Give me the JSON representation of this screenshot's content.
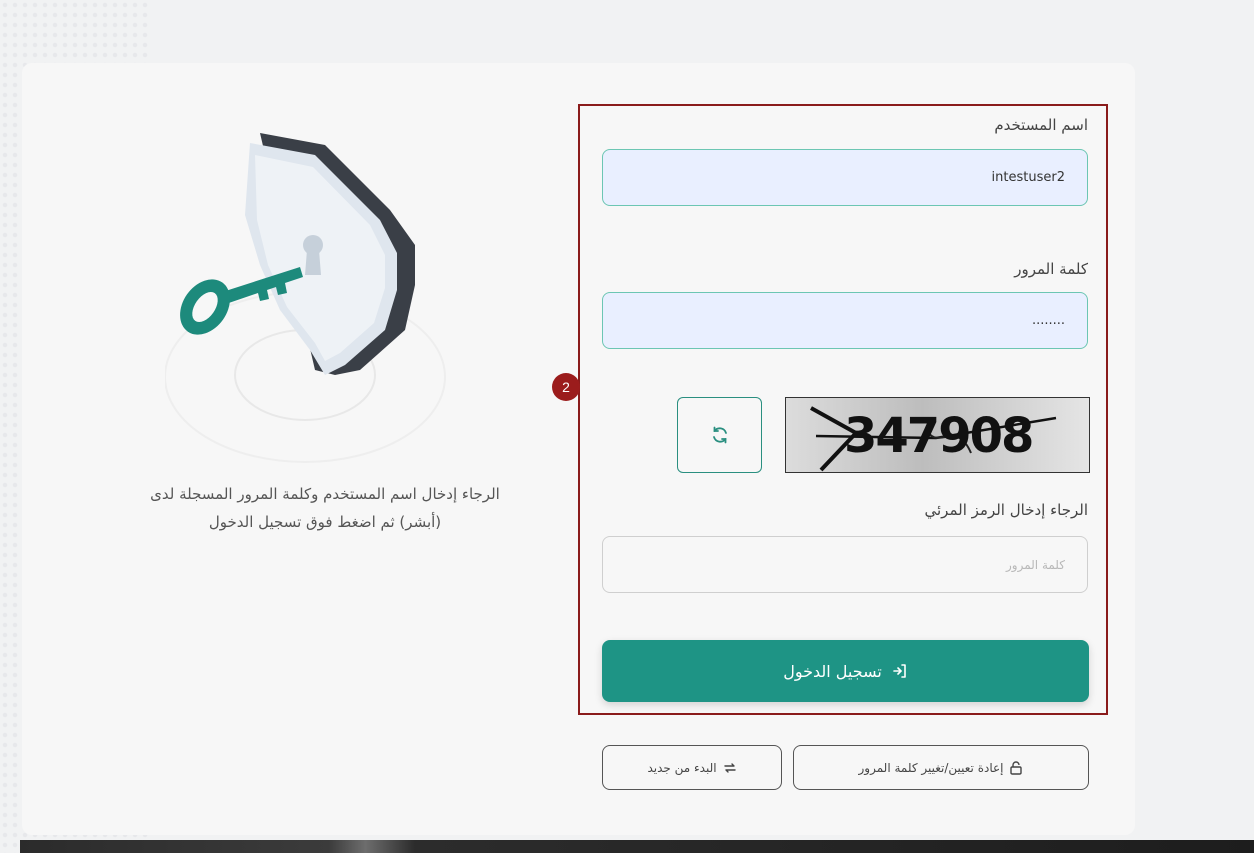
{
  "form": {
    "username_label": "اسم المستخدم",
    "username_value": "intestuser2",
    "password_label": "كلمة المرور",
    "password_value": "........",
    "captcha_label": "الرجاء إدخال الرمز المرئي",
    "captcha_placeholder": "كلمة المرور",
    "captcha_text": "347908",
    "login_label": "تسجيل الدخول"
  },
  "annotation": {
    "step": "2"
  },
  "actions": {
    "reset_password_label": "إعادة تعيين/تغيير كلمة المرور",
    "start_over_label": "البدء من جديد"
  },
  "info": {
    "description": "الرجاء إدخال اسم المستخدم وكلمة المرور المسجلة لدى (أبشر) ثم اضغط فوق تسجيل الدخول"
  },
  "icons": {
    "refresh": "refresh-icon",
    "login": "login-arrow-icon",
    "lock": "lock-icon",
    "swap": "swap-icon",
    "illustration": "shield-key-illustration"
  },
  "colors": {
    "primary": "#1e9485",
    "highlight_border": "#8a1b1b",
    "step_badge": "#9b1c1c",
    "input_fill": "#e9efff"
  }
}
